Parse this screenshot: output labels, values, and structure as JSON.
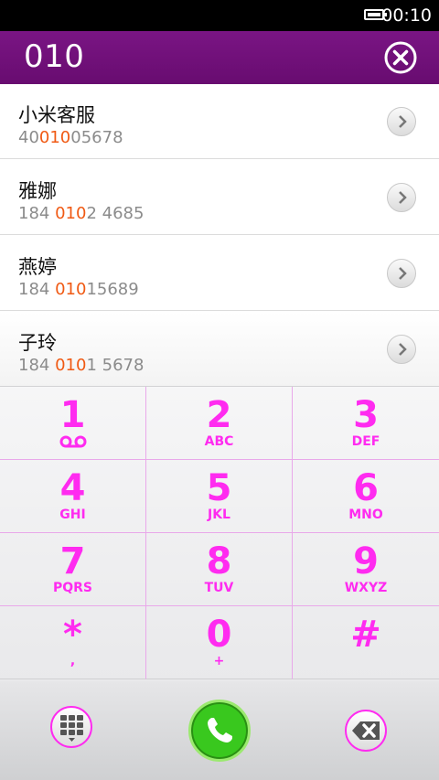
{
  "status_bar": {
    "time": "00:10"
  },
  "header": {
    "dialed_number": "010"
  },
  "contacts": [
    {
      "name": "小米客服",
      "number_before": "40",
      "number_match": "010",
      "number_after": "05678"
    },
    {
      "name": "雅娜",
      "number_before": "184 ",
      "number_match": "010",
      "number_after": "2 4685"
    },
    {
      "name": "燕婷",
      "number_before": "184 ",
      "number_match": "010",
      "number_after": "15689"
    },
    {
      "name": "子玲",
      "number_before": "184 ",
      "number_match": "010",
      "number_after": "1 5678"
    }
  ],
  "keypad": [
    {
      "digit": "1",
      "letters": ""
    },
    {
      "digit": "2",
      "letters": "ABC"
    },
    {
      "digit": "3",
      "letters": "DEF"
    },
    {
      "digit": "4",
      "letters": "GHI"
    },
    {
      "digit": "5",
      "letters": "JKL"
    },
    {
      "digit": "6",
      "letters": "MNO"
    },
    {
      "digit": "7",
      "letters": "PQRS"
    },
    {
      "digit": "8",
      "letters": "TUV"
    },
    {
      "digit": "9",
      "letters": "WXYZ"
    },
    {
      "digit": "*",
      "letters": ","
    },
    {
      "digit": "0",
      "letters": "+"
    },
    {
      "digit": "#",
      "letters": ""
    }
  ],
  "icons": {
    "voicemail": "voicemail-icon",
    "clear": "clear-icon",
    "contact_detail": "chevron-right-icon",
    "dialpad": "dialpad-icon",
    "call": "phone-icon",
    "delete": "backspace-icon"
  },
  "colors": {
    "header": "#6e0f78",
    "accent": "#ff2bf0",
    "match_highlight": "#f05a14",
    "call": "#39c81e"
  }
}
